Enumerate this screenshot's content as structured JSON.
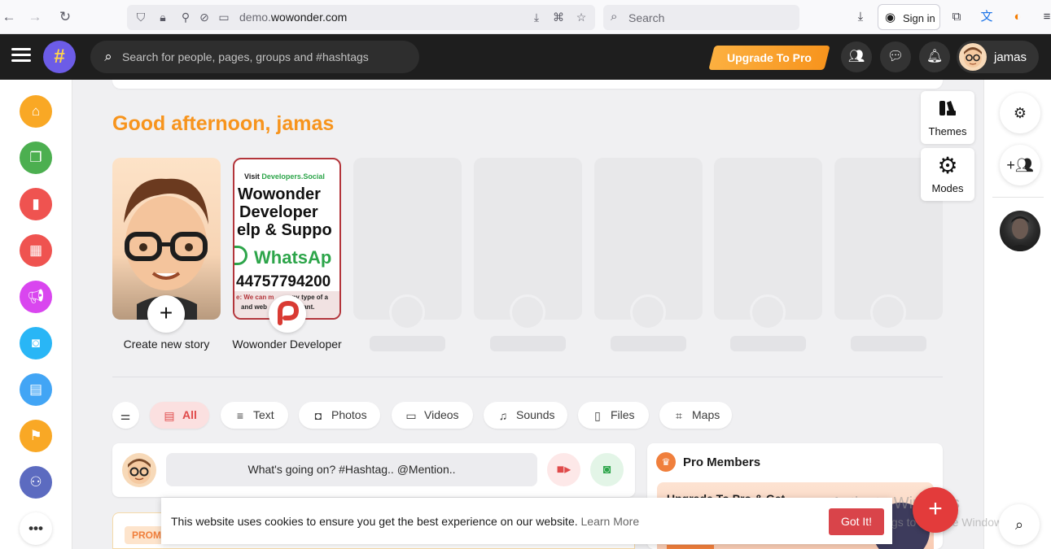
{
  "browser": {
    "url_prefix": "demo.",
    "url_domain": "wowonder.com",
    "search_placeholder": "Search",
    "signin_label": "Sign in"
  },
  "header": {
    "logo_glyph": "#",
    "search_placeholder": "Search for people, pages, groups and #hashtags",
    "upgrade_label": "Upgrade To Pro",
    "username": "jamas"
  },
  "sidebar_left": {
    "items": [
      {
        "name": "home",
        "color": "#f9a825",
        "icon": "home-icon"
      },
      {
        "name": "albums",
        "color": "#4caf50",
        "icon": "albums-icon"
      },
      {
        "name": "saved",
        "color": "#ef5350",
        "icon": "bookmark-icon"
      },
      {
        "name": "events",
        "color": "#ef5350",
        "icon": "calendar-icon"
      },
      {
        "name": "ads",
        "color": "#d946ef",
        "icon": "megaphone-icon"
      },
      {
        "name": "market",
        "color": "#29b6f6",
        "icon": "shopping-bag-icon"
      },
      {
        "name": "blog",
        "color": "#42a5f5",
        "icon": "blog-icon"
      },
      {
        "name": "pages",
        "color": "#f9a825",
        "icon": "flag-icon"
      },
      {
        "name": "groups",
        "color": "#5c6bc0",
        "icon": "group-icon"
      },
      {
        "name": "more",
        "color": "#ffffff",
        "icon": "more-icon"
      }
    ]
  },
  "greeting": "Good afternoon, jamas",
  "stories": {
    "create_label": "Create new story",
    "dev_label": "Wowonder Developer",
    "dev_card": {
      "visit": "Visit",
      "site": "Developers.Social",
      "line1": "Wowonder",
      "line2": "Developer",
      "line3": "elp & Suppo",
      "whatsapp": "WhatsAp",
      "phone": "44757794200",
      "note1": "e: We can m",
      "note1b": "ny type of a",
      "note2": "and web",
      "note2b": "ou want."
    }
  },
  "side_cards": {
    "themes_label": "Themes",
    "modes_label": "Modes"
  },
  "filters": [
    {
      "label": "All",
      "active": true
    },
    {
      "label": "Text"
    },
    {
      "label": "Photos"
    },
    {
      "label": "Videos"
    },
    {
      "label": "Sounds"
    },
    {
      "label": "Files"
    },
    {
      "label": "Maps"
    }
  ],
  "composer": {
    "placeholder": "What's going on? #Hashtag.. @Mention.."
  },
  "promo_badge": "PROMO",
  "pro_members": {
    "title": "Pro Members",
    "banner_title": "Upgrade To Pro & Get"
  },
  "cookie": {
    "text": "This website uses cookies to ensure you get the best experience on our website.",
    "learn_more": "Learn More",
    "button": "Got It!"
  },
  "watermark": {
    "line1": "Activate Windows",
    "line2": "Go to Settings to activate Windows."
  },
  "colors": {
    "accent_orange": "#f7941d",
    "header_bg": "#1e1e1e",
    "red": "#e33b3b"
  }
}
